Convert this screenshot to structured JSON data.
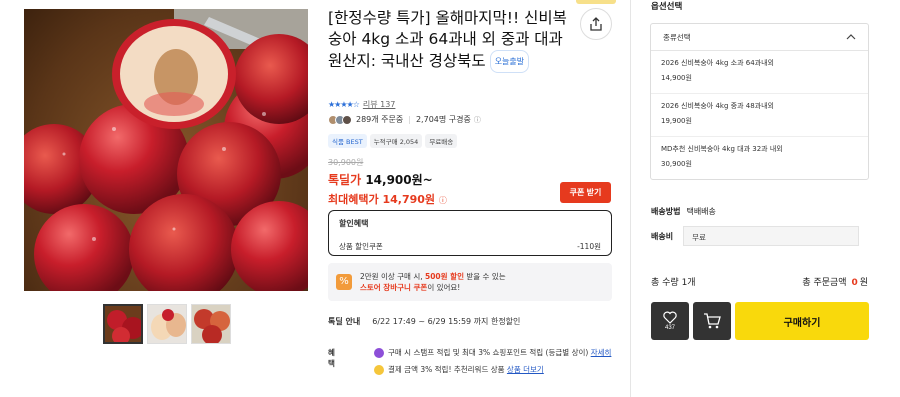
{
  "product": {
    "title_line1": "[한정수량 특가] 올해마지막!! 신비복숭아 4kg 소과 64과내 외 중과 대과",
    "title_line2": "원산지: 국내산 경상북도",
    "delivery_badge": "오늘출발",
    "review_text": "리뷰 137",
    "orders": "289개 주문중",
    "subscribers": "2,704명 구경중",
    "tags": [
      "식품 BEST",
      "누적구매 2,054",
      "무료배송"
    ],
    "original_price": "30,900원",
    "deal_label": "톡딜가",
    "deal_price": "14,900원~",
    "max_label": "최대혜택가",
    "max_price": "14,790원",
    "coupon_button": "쿠폰 받기",
    "discount": {
      "heading": "할인혜택",
      "row_label": "상품 할인쿠폰",
      "row_value": "-110원"
    },
    "promo": {
      "line1_a": "2만원 이상 구매 시, ",
      "line1_hl": "500원 할인",
      "line1_b": " 받을 수 있는",
      "line2_hl": "스토어 장바구니 쿠폰",
      "line2_b": "이 있어요!"
    },
    "deal_info_label": "톡딜 안내",
    "deal_info_value": "6/22 17:49 ~ 6/29 15:59 까지 한정할인",
    "benefit_label": "혜택",
    "benefit1": "구매 시 스탬프 적립 및 최대 3% 쇼핑포인트 적립 (등급별 상이)",
    "benefit1_link": "자세히",
    "benefit2": "결제 금액 3% 적립! 추천리워드 상품",
    "benefit2_link": "상품 더보기"
  },
  "options": {
    "title": "옵션선택",
    "header": "종류선택",
    "items": [
      {
        "name": "2026 신비복숭아 4kg 소과 64과내외",
        "price": "14,900원"
      },
      {
        "name": "2026 신비복숭아 4kg 중과 48과내외",
        "price": "19,900원"
      },
      {
        "name": "MD추천 신비복숭아 4kg 대과 32과 내외",
        "price": "30,900원"
      }
    ]
  },
  "shipping": {
    "method_label": "배송방법",
    "method_value": "택배배송",
    "fee_label": "배송비",
    "fee_value": "무료"
  },
  "totals": {
    "qty_label": "총 수량",
    "qty_value": "1개",
    "amount_label": "총 주문금액",
    "amount_value": "0",
    "amount_unit": "원"
  },
  "actions": {
    "wish_count": "437",
    "buy_label": "구매하기"
  },
  "colors": {
    "accent_red": "#e63a1e",
    "buy_yellow": "#f9d90c",
    "dark_button": "#333333"
  }
}
